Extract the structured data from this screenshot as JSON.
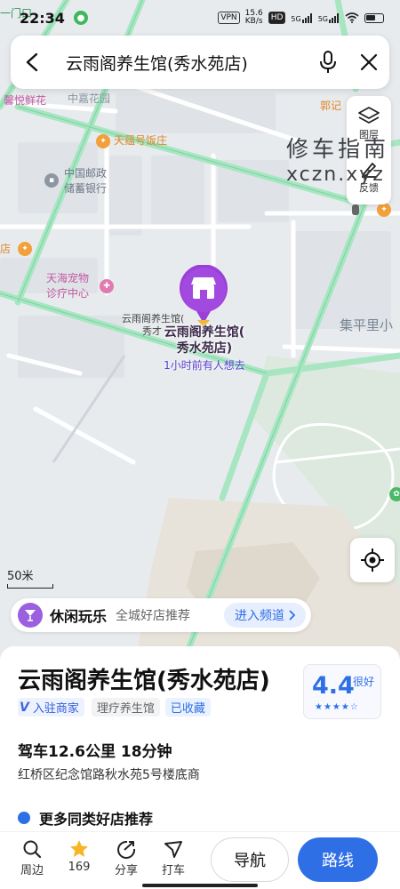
{
  "status_bar": {
    "time": "22:34",
    "vpn": "VPN",
    "net_speed_top": "15.6",
    "net_speed_bottom": "KB/s",
    "hd": "HD",
    "sim1": "5G",
    "sim2": "5G",
    "battery_icon": "battery-icon"
  },
  "search": {
    "query": "云雨阁养生馆(秀水苑店)",
    "back_icon": "back-arrow-icon",
    "voice_icon": "microphone-icon",
    "close_icon": "close-icon"
  },
  "controls": {
    "layers_label": "图层",
    "feedback_label": "反馈"
  },
  "watermark": {
    "line1": "修车指南",
    "line2": "xczn.xyz"
  },
  "map_labels": {
    "top_left": "一门口",
    "xinyue": "馨悦鲜花",
    "zhongjia": "中嘉花园",
    "tiandi": "天蕴号饭庄",
    "post_bank_1": "中国邮政",
    "post_bank_2": "储蓄银行",
    "shop_left": "店",
    "pet_1": "天海宠物",
    "pet_2": "诊疗中心",
    "guo": "郭记",
    "jiping": "集平里小",
    "poi_small": "云雨阁养生馆(",
    "poi_small2": "秀才"
  },
  "marker": {
    "name_line1": "云雨阁养生馆(",
    "name_line2": "秀水苑店)",
    "sub": "1小时前有人想去",
    "color": "#9b3fd6"
  },
  "scale": {
    "label": "50米"
  },
  "leisure": {
    "title": "休闲玩乐",
    "subtitle": "全城好店推荐",
    "button": "进入频道"
  },
  "sheet": {
    "title": "云雨阁养生馆(秀水苑店)",
    "tag_verified": "入驻商家",
    "tag_category": "理疗养生馆",
    "tag_saved": "已收藏",
    "rating": "4.4",
    "rating_word": "很好",
    "rating_stars": 4,
    "drive": "驾车12.6公里  18分钟",
    "address": "红桥区纪念馆路秋水苑5号楼底商",
    "more": "更多同类好店推荐"
  },
  "bottom_nav": {
    "nearby": "周边",
    "favorites_count": "169",
    "share": "分享",
    "taxi": "打车",
    "navigate": "导航",
    "route": "路线"
  },
  "colors": {
    "accent": "#2f6fe6",
    "marker": "#9b3fd6",
    "road": "#a8e6c2",
    "park": "#dbe8dc"
  }
}
